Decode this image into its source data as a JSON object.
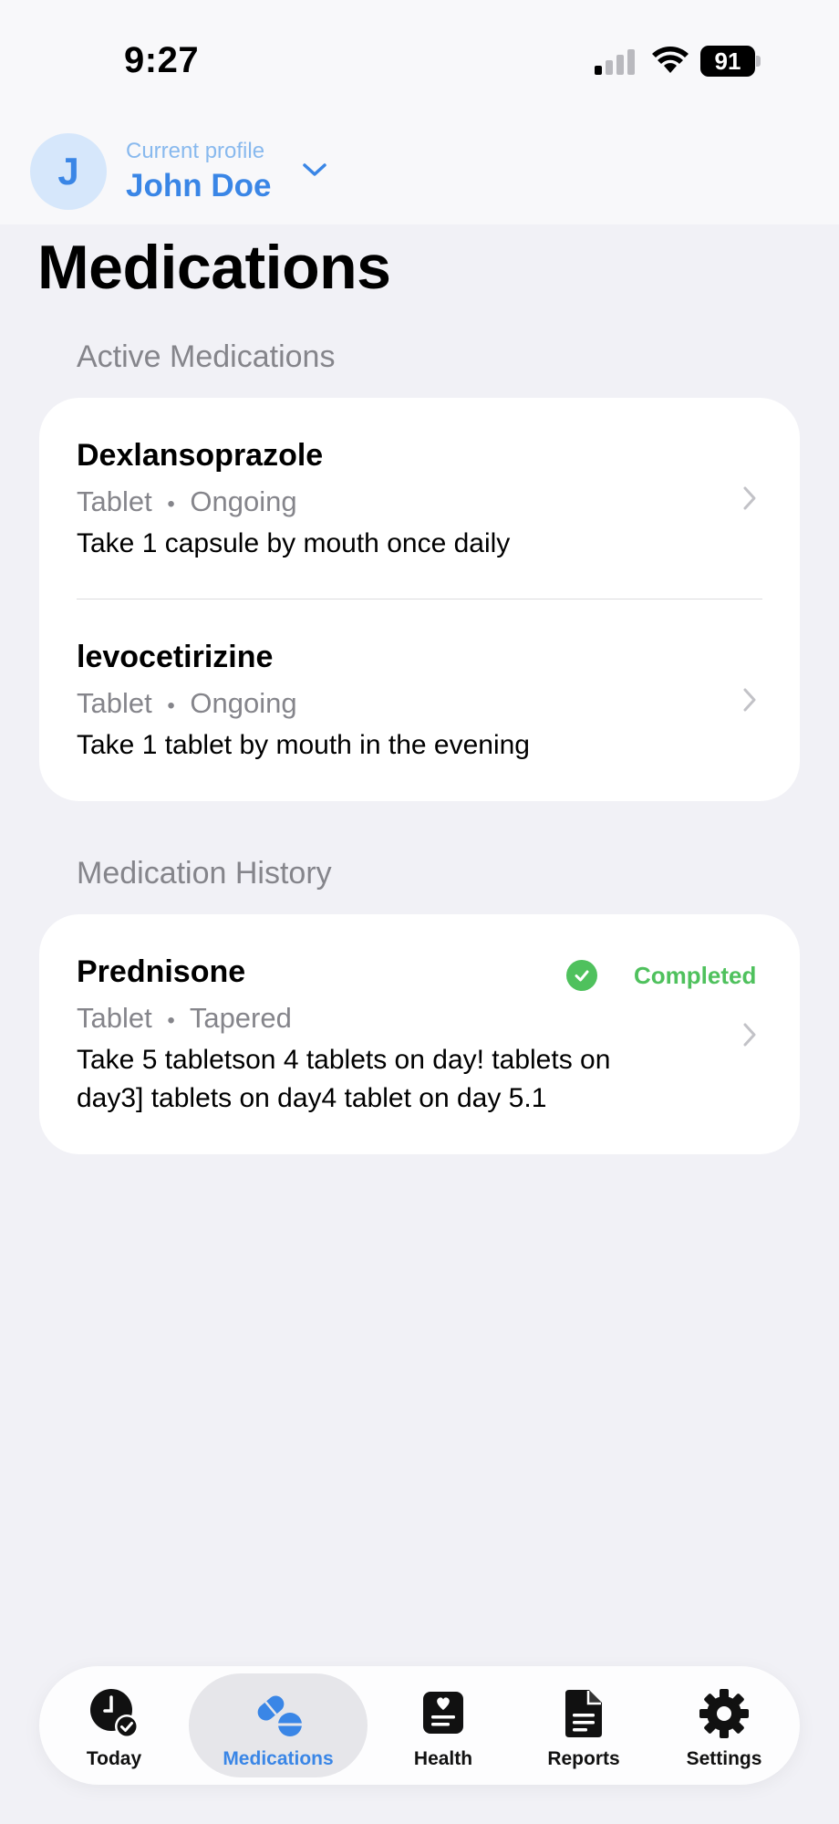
{
  "status_bar": {
    "time": "9:27",
    "battery": "91"
  },
  "profile": {
    "avatar_letter": "J",
    "label": "Current profile",
    "name": "John Doe"
  },
  "page_title": "Medications",
  "active": {
    "title": "Active Medications",
    "items": [
      {
        "name": "Dexlansoprazole",
        "form": "Tablet",
        "status": "Ongoing",
        "instructions": "Take 1 capsule by mouth once daily"
      },
      {
        "name": "levocetirizine",
        "form": "Tablet",
        "status": "Ongoing",
        "instructions": "Take 1 tablet by mouth in the evening"
      }
    ]
  },
  "history": {
    "title": "Medication History",
    "items": [
      {
        "name": "Prednisone",
        "form": "Tablet",
        "status": "Tapered",
        "badge": "Completed",
        "instructions_line1": "Take 5 tabletson 4 tablets on day! tablets on",
        "instructions_line2": "day3] tablets on day4 tablet on day 5.1"
      }
    ]
  },
  "tabs": [
    {
      "label": "Today",
      "icon": "clock-check-icon"
    },
    {
      "label": "Medications",
      "icon": "pills-icon",
      "active": true
    },
    {
      "label": "Health",
      "icon": "health-record-icon"
    },
    {
      "label": "Reports",
      "icon": "document-icon"
    },
    {
      "label": "Settings",
      "icon": "gear-icon"
    }
  ],
  "colors": {
    "accent": "#3a86e6",
    "success": "#4fc15d",
    "secondary_text": "#85858b",
    "background": "#f1f1f6"
  },
  "separator": "•"
}
